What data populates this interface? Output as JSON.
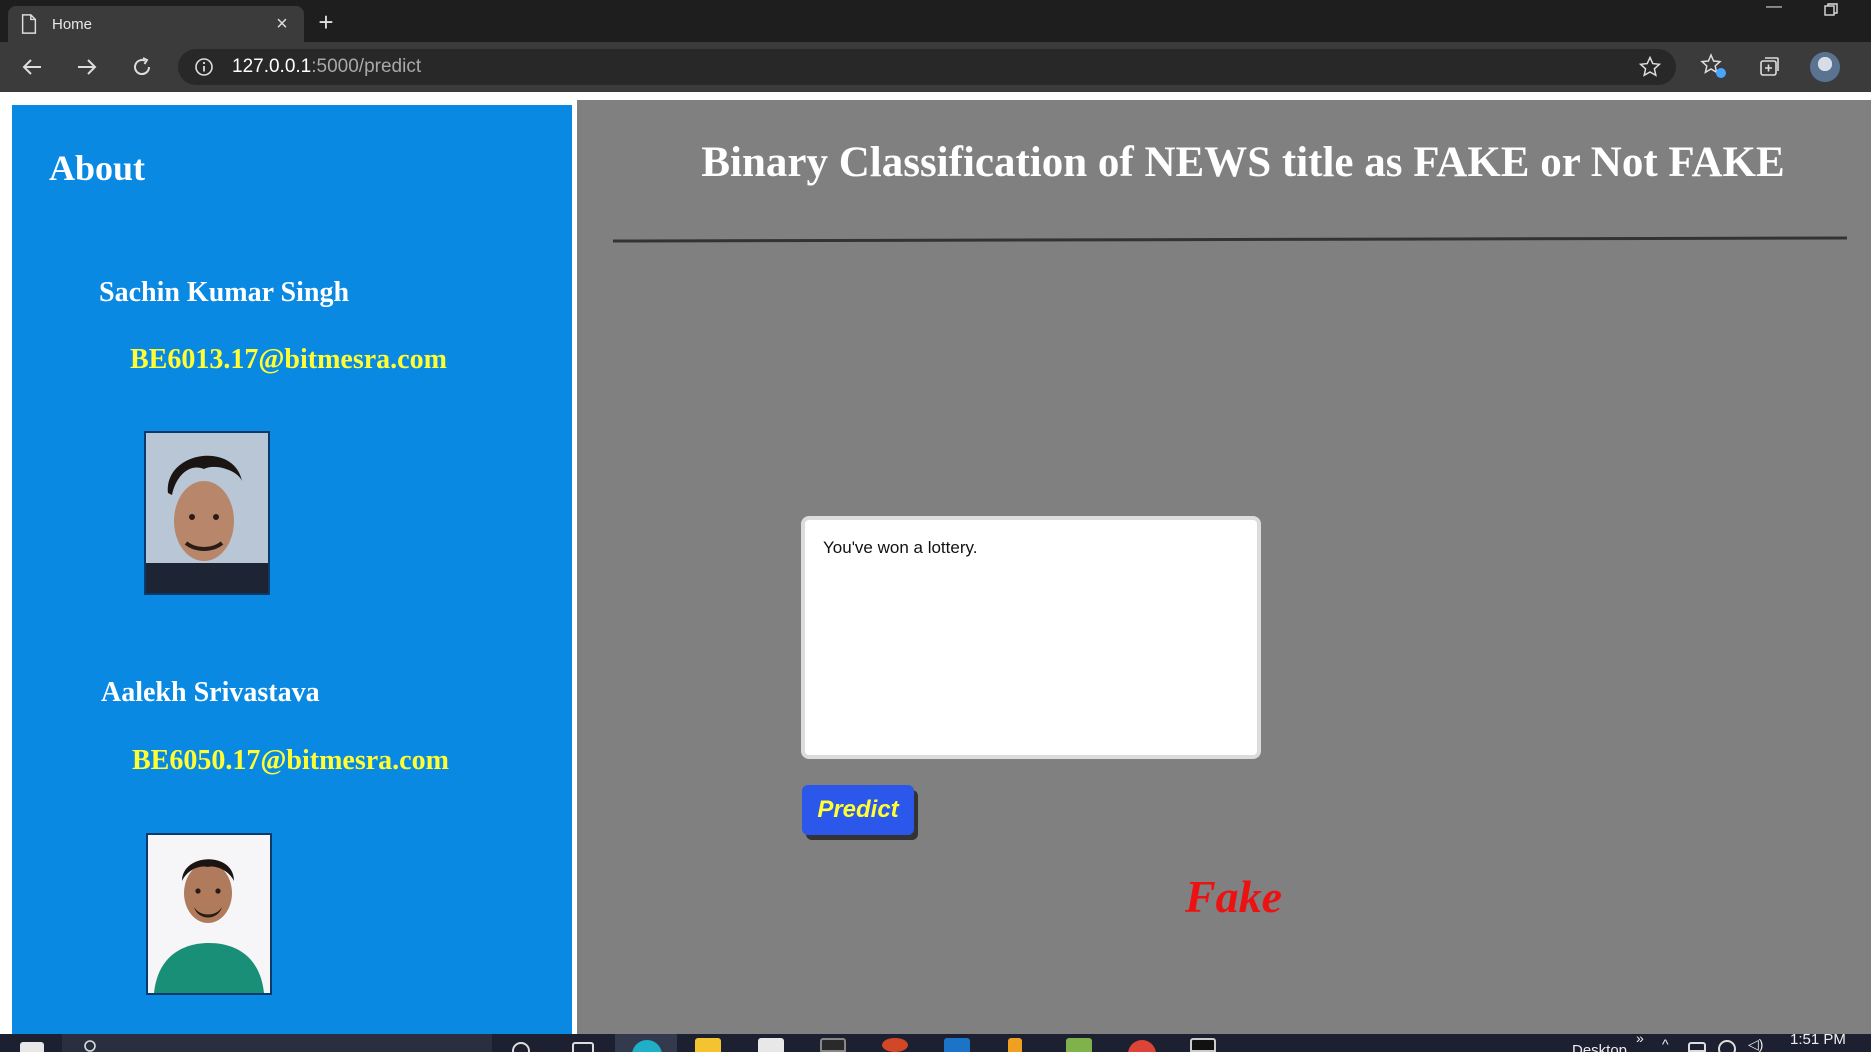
{
  "browser": {
    "tab_title": "Home",
    "url_host": "127.0.0.1",
    "url_path": ":5000/predict"
  },
  "sidebar": {
    "heading": "About",
    "people": [
      {
        "name": "Sachin Kumar Singh",
        "email": "BE6013.17@bitmesra.com"
      },
      {
        "name": "Aalekh Srivastava",
        "email": "BE6050.17@bitmesra.com"
      }
    ]
  },
  "main": {
    "title": "Binary Classification of NEWS title as FAKE or Not FAKE",
    "input_value": "You've won a lottery.",
    "predict_label": "Predict",
    "result": "Fake"
  },
  "colors": {
    "sidebar_bg": "#0a89e3",
    "main_bg": "#808080",
    "email_color": "#ffff33",
    "button_bg": "#2b57ea",
    "result_color": "#ee1111"
  },
  "taskbar": {
    "desktop_label": "Desktop",
    "clock": "1:51 PM"
  }
}
